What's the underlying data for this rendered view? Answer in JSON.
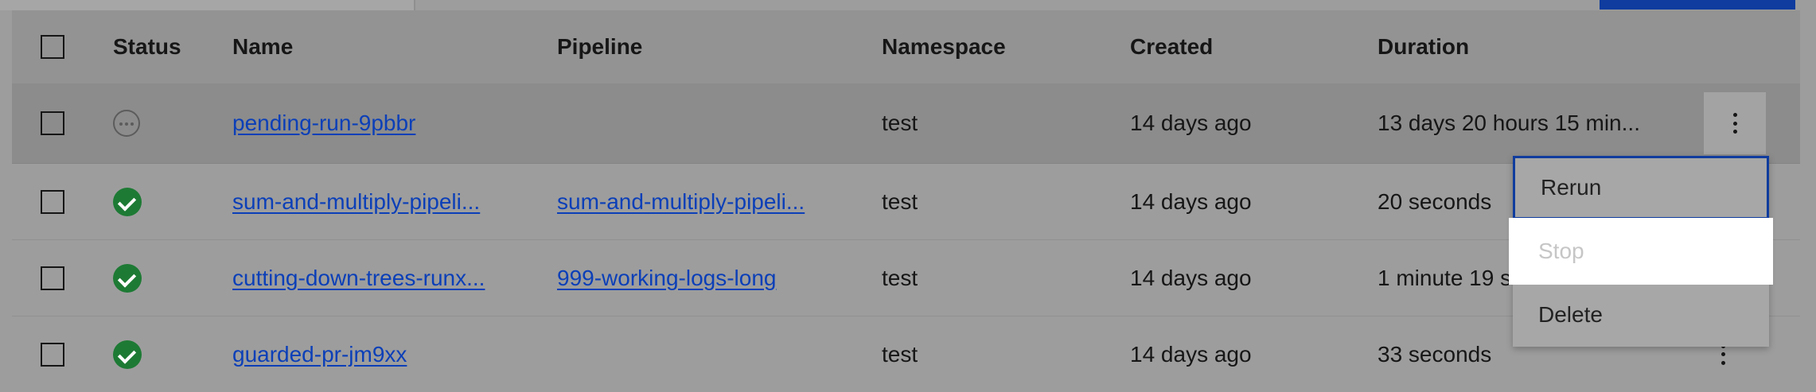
{
  "table": {
    "headers": {
      "status": "Status",
      "name": "Name",
      "pipeline": "Pipeline",
      "namespace": "Namespace",
      "created": "Created",
      "duration": "Duration"
    },
    "rows": [
      {
        "status": "pending",
        "name": "pending-run-9pbbr",
        "pipeline": "",
        "namespace": "test",
        "created": "14 days ago",
        "duration": "13 days 20 hours 15 min..."
      },
      {
        "status": "succeeded",
        "name": "sum-and-multiply-pipeli...",
        "pipeline": "sum-and-multiply-pipeli...",
        "namespace": "test",
        "created": "14 days ago",
        "duration": "20 seconds"
      },
      {
        "status": "succeeded",
        "name": "cutting-down-trees-runx...",
        "pipeline": "999-working-logs-long",
        "namespace": "test",
        "created": "14 days ago",
        "duration": "1 minute 19 s"
      },
      {
        "status": "succeeded",
        "name": "guarded-pr-jm9xx",
        "pipeline": "",
        "namespace": "test",
        "created": "14 days ago",
        "duration": "33 seconds"
      }
    ]
  },
  "overflow_menu": {
    "items": [
      "Rerun",
      "Stop",
      "Delete"
    ],
    "focused": "Rerun",
    "disabled": [
      "Stop"
    ]
  },
  "icons": {
    "select_all": "checkbox-icon",
    "pending": "pending-status-icon",
    "succeeded": "checkmark-filled-icon",
    "row_menu": "overflow-menu-vertical-icon"
  },
  "colors": {
    "link": "#0b3fb8",
    "success": "#1d7a34",
    "focus": "#0f3c9e"
  }
}
